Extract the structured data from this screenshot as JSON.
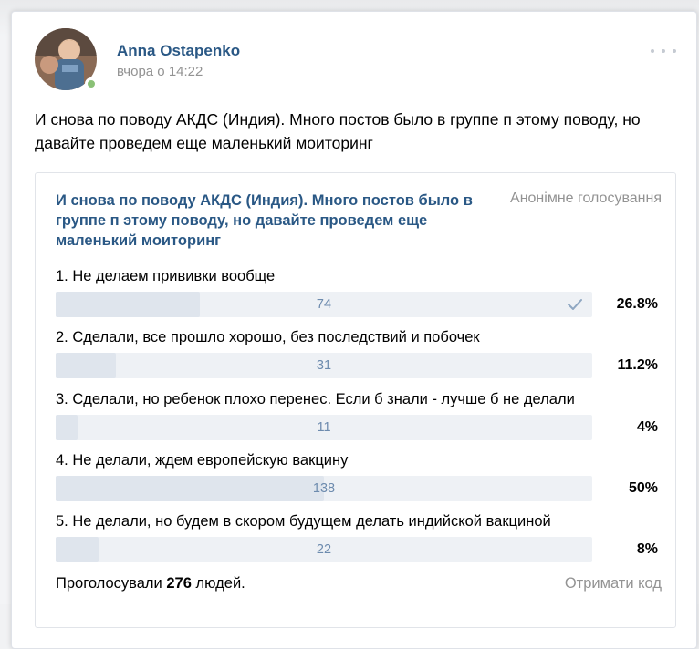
{
  "post": {
    "author": "Anna Ostapenko",
    "time": "вчора о 14:22",
    "text": "И снова по поводу АКДС (Индия). Много постов было в группе п этому поводу, но давайте проведем еще маленький моиторинг"
  },
  "poll": {
    "title": "И снова по поводу АКДС (Индия). Много постов было в группе п этому поводу, но давайте проведем еще маленький моиторинг",
    "type_label": "Анонімне голосування",
    "options": [
      {
        "label": "1. Не делаем прививки вообще",
        "count": "74",
        "percent": "26.8%",
        "share": 0.268,
        "voted": true
      },
      {
        "label": "2. Сделали, все прошло хорошо, без последствий и побочек",
        "count": "31",
        "percent": "11.2%",
        "share": 0.112,
        "voted": false
      },
      {
        "label": "3. Сделали, но ребенок плохо перенес. Если б знали - лучше б не делали",
        "count": "11",
        "percent": "4%",
        "share": 0.04,
        "voted": false
      },
      {
        "label": "4. Не делали, ждем европейскую вакцину",
        "count": "138",
        "percent": "50%",
        "share": 0.5,
        "voted": false
      },
      {
        "label": "5. Не делали, но будем в скором будущем делать индийской вакциной",
        "count": "22",
        "percent": "8%",
        "share": 0.08,
        "voted": false
      }
    ],
    "footer_prefix": "Проголосували",
    "footer_total": "276",
    "footer_suffix": "людей.",
    "get_code_label": "Отримати код"
  },
  "colors": {
    "link": "#2a5885",
    "bar_bg": "#eef1f5",
    "bar_fill": "#dfe5ed",
    "online": "#8ac176"
  }
}
